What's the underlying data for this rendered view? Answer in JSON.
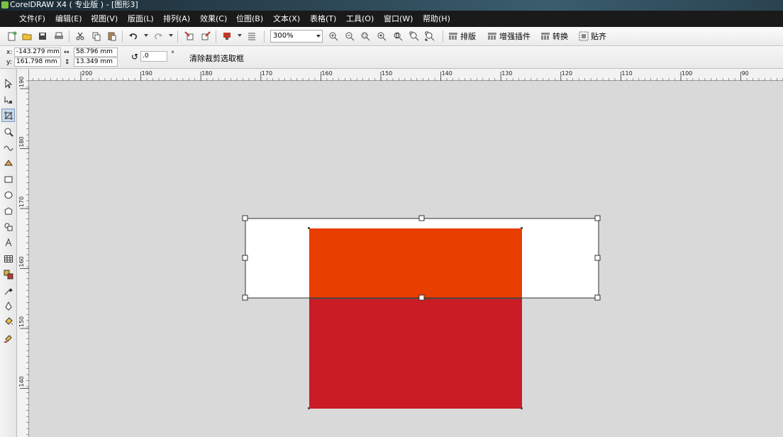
{
  "window": {
    "title": "CorelDRAW X4 ( 专业版 ) - [图形3]"
  },
  "menu": {
    "items": [
      {
        "label": "文件(F)"
      },
      {
        "label": "编辑(E)"
      },
      {
        "label": "视图(V)"
      },
      {
        "label": "版面(L)"
      },
      {
        "label": "排列(A)"
      },
      {
        "label": "效果(C)"
      },
      {
        "label": "位图(B)"
      },
      {
        "label": "文本(X)"
      },
      {
        "label": "表格(T)"
      },
      {
        "label": "工具(O)"
      },
      {
        "label": "窗口(W)"
      },
      {
        "label": "帮助(H)"
      }
    ]
  },
  "toolbar": {
    "zoom": "300%",
    "plugins": [
      {
        "label": "排版"
      },
      {
        "label": "增强插件"
      },
      {
        "label": "转换"
      },
      {
        "label": "贴齐"
      }
    ]
  },
  "property_bar": {
    "x_label": "x:",
    "x_value": "-143.279 mm",
    "y_label": "y:",
    "y_value": "161.798 mm",
    "width_value": "58.796 mm",
    "height_value": "13.349 mm",
    "rotation_value": ".0",
    "degree_symbol": "°",
    "action_label": "清除裁剪选取框"
  },
  "rulers": {
    "horizontal_labels": [
      "200",
      "190",
      "180",
      "170",
      "160",
      "150",
      "140",
      "130",
      "120",
      "110",
      "100",
      "90"
    ],
    "vertical_labels": [
      "190",
      "180",
      "170",
      "160",
      "150",
      "140"
    ]
  },
  "colors": {
    "orange_rect": "#e83e00",
    "red_rect": "#c91c24",
    "selection_fill": "#ffffff",
    "canvas_bg": "#d9d9d9",
    "menubar_bg": "#1a1a1a"
  },
  "toolbox": {
    "tools": [
      "pick-tool-icon",
      "shape-tool-icon",
      "crop-tool-icon",
      "zoom-tool-icon",
      "freehand-tool-icon",
      "smart-fill-icon",
      "rectangle-tool-icon",
      "ellipse-tool-icon",
      "polygon-tool-icon",
      "basic-shapes-icon",
      "text-tool-icon",
      "table-tool-icon",
      "interactive-blend-icon",
      "eyedropper-icon",
      "outline-pen-icon",
      "fill-tool-icon",
      "interactive-fill-icon"
    ]
  }
}
